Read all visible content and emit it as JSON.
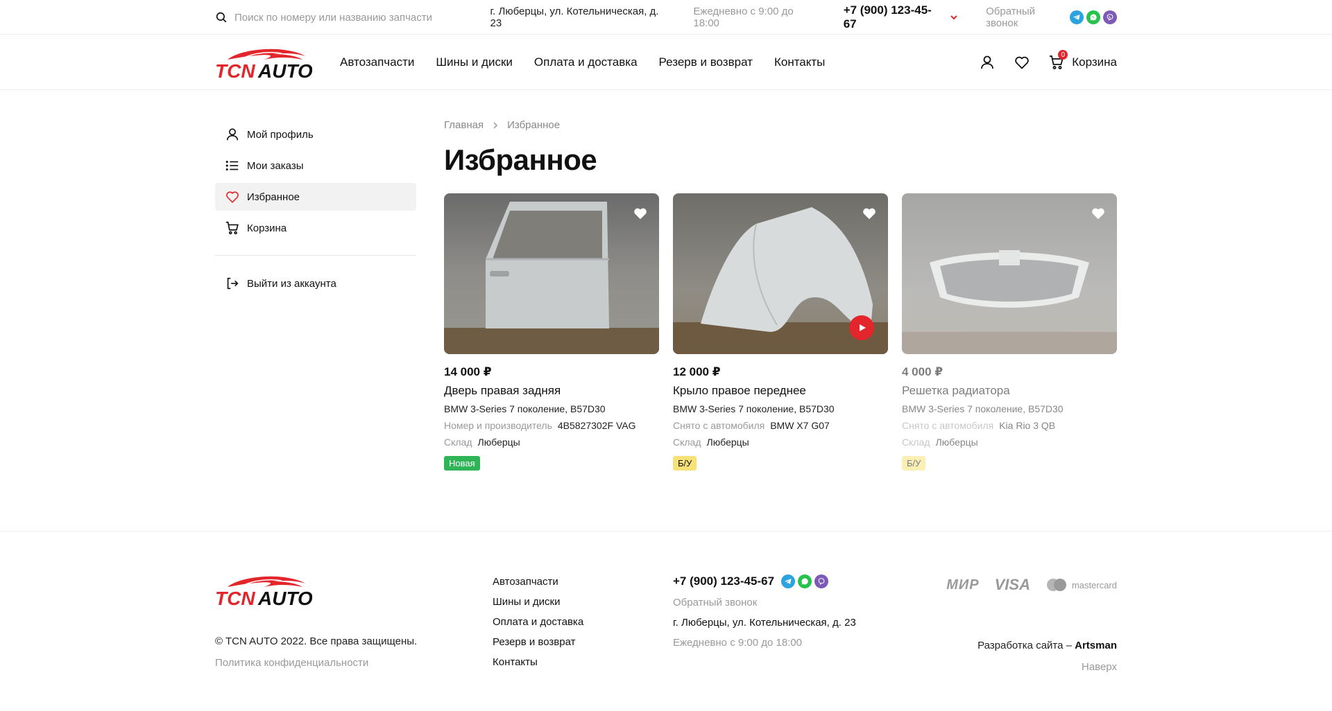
{
  "topbar": {
    "search_placeholder": "Поиск по номеру или названию запчасти",
    "address": "г. Люберцы, ул. Котельническая, д. 23",
    "hours": "Ежедневно с 9:00 до 18:00",
    "phone": "+7 (900) 123-45-67",
    "callback": "Обратный звонок",
    "messengers": [
      "telegram-icon",
      "whatsapp-icon",
      "viber-icon"
    ]
  },
  "header": {
    "logo_text": "TCNAUTO",
    "nav": [
      "Автозапчасти",
      "Шины и диски",
      "Оплата и доставка",
      "Резерв и возврат",
      "Контакты"
    ],
    "cart_count": "0",
    "cart_label": "Корзина"
  },
  "sidebar": {
    "items": [
      {
        "label": "Мой профиль",
        "icon": "user-icon"
      },
      {
        "label": "Мои заказы",
        "icon": "list-icon"
      },
      {
        "label": "Избранное",
        "icon": "heart-icon"
      },
      {
        "label": "Корзина",
        "icon": "cart-icon"
      }
    ],
    "logout": "Выйти из аккаунта"
  },
  "breadcrumb": [
    "Главная",
    "Избранное"
  ],
  "page_title": "Избранное",
  "products": [
    {
      "price": "14 000 ₽",
      "name": "Дверь правая задняя",
      "model": "BMW 3-Series 7 поколение, B57D30",
      "meta1_key": "Номер и производитель",
      "meta1_val": "4B5827302F VAG",
      "meta2_key": "Склад",
      "meta2_val": "Люберцы",
      "tag": "Новая"
    },
    {
      "price": "12 000 ₽",
      "name": "Крыло правое переднее",
      "model": "BMW 3-Series 7 поколение, B57D30",
      "meta1_key": "Снято с автомобиля",
      "meta1_val": "BMW X7 G07",
      "meta2_key": "Склад",
      "meta2_val": "Люберцы",
      "tag": "Б/У"
    },
    {
      "price": "4 000 ₽",
      "name": "Решетка радиатора",
      "model": "BMW 3-Series 7 поколение, B57D30",
      "meta1_key": "Снято с автомобиля",
      "meta1_val": "Kia Rio 3 QB",
      "meta2_key": "Склад",
      "meta2_val": "Люберцы",
      "tag": "Б/У"
    }
  ],
  "footer": {
    "copyright": "© TCN AUTO 2022. Все права защищены.",
    "policy": "Политика конфиденциальности",
    "nav": [
      "Автозапчасти",
      "Шины и диски",
      "Оплата и доставка",
      "Резерв и возврат",
      "Контакты"
    ],
    "phone": "+7 (900) 123-45-67",
    "callback": "Обратный звонок",
    "address": "г. Люберцы, ул. Котельническая, д. 23",
    "hours": "Ежедневно с 9:00 до 18:00",
    "payments": [
      "МИР",
      "VISA",
      "mastercard"
    ],
    "dev_prefix": "Разработка сайта – ",
    "dev_name": "Artsman",
    "to_top": "Наверх"
  },
  "colors": {
    "accent": "#e3262c",
    "tag_new": "#2fb457",
    "tag_used": "#f7e27a",
    "muted_text": "#999999"
  }
}
